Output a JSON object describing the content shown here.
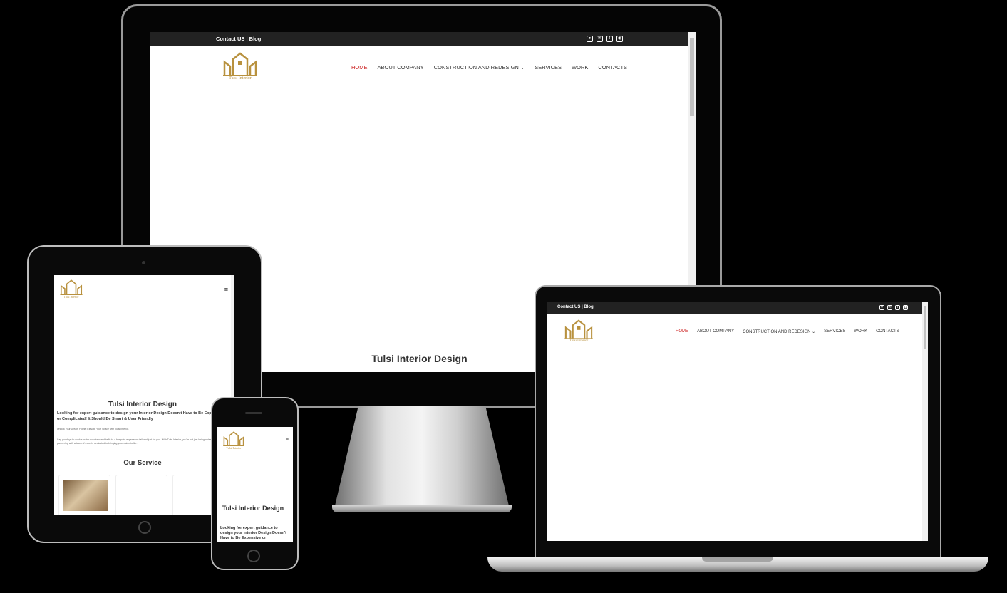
{
  "site": {
    "topbar_text": "Contact US | Blog",
    "logo_text": "Tulsi Interior",
    "hero_title": "Tulsi Interior Design",
    "nav": [
      "HOME",
      "ABOUT COMPANY",
      "CONSTRUCTION AND REDESIGN ⌄",
      "SERVICES",
      "WORK",
      "CONTACTS"
    ],
    "topbar_icons": [
      "whatsapp-icon",
      "mail-icon",
      "facebook-icon",
      "instagram-icon"
    ],
    "accent_color": "#c22222",
    "logo_color": "#b8913e"
  },
  "tablet": {
    "menu_glyph": "≡",
    "title": "Tulsi Interior Design",
    "subtitle": "Looking for expert guidance to design your Interior Design Doesn't Have to Be Expensive or Complicated! It Should Be Smart & User Friendly",
    "tagline": "Unlock Your Dream Home: Elevate Your Space with Tulsi Interior.",
    "body": "Say goodbye to cookie-cutter solutions and hello to a bespoke experience tailored just for you. With Tulsi Interior, you're not just hiring a designer; you're partnering with a team of experts dedicated to bringing your vision to life.",
    "service_heading": "Our Service"
  },
  "phone": {
    "menu_glyph": "≡",
    "title": "Tulsi Interior Design",
    "subtitle": "Looking for expert guidance to design your Interior Design Doesn't Have to Be Expensive or"
  },
  "slider": {
    "prev_glyph": "‹"
  }
}
